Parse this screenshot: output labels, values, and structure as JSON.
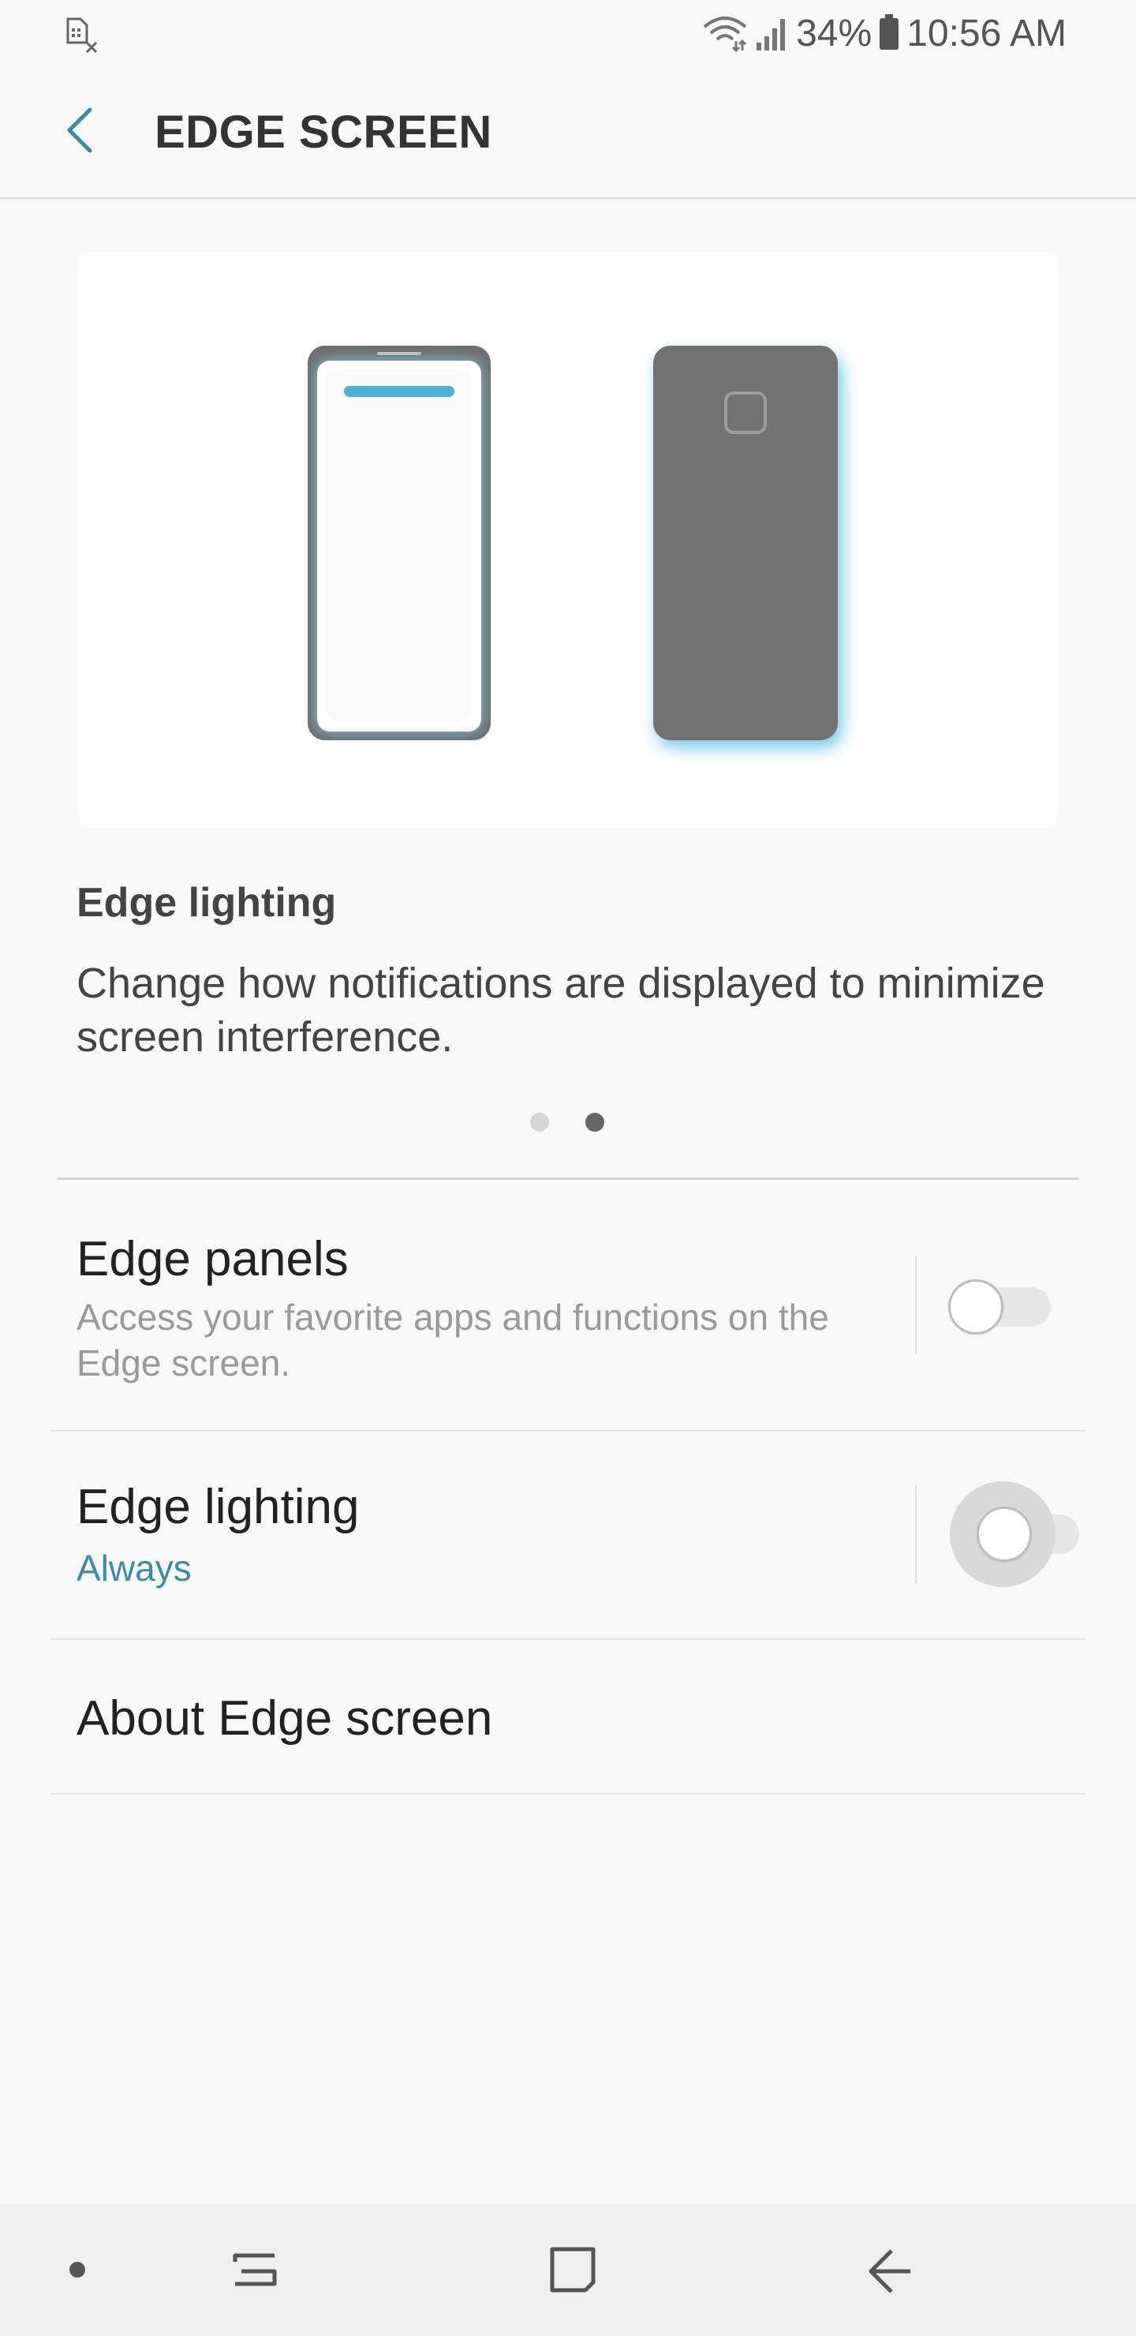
{
  "status_bar": {
    "battery_percent": "34%",
    "time": "10:56 AM",
    "icons": [
      "sim-card-off-icon",
      "wifi-icon",
      "signal-icon",
      "battery-icon"
    ]
  },
  "header": {
    "title": "EDGE SCREEN",
    "back_icon": "back-arrow-icon",
    "accent_color": "#3e8ba8"
  },
  "carousel": {
    "heading": "Edge lighting",
    "description": "Change how notifications are displayed to minimize screen interference.",
    "page_count": 2,
    "active_page": 2
  },
  "settings": [
    {
      "title": "Edge panels",
      "summary": "Access your favorite apps and functions on the Edge screen.",
      "switch_on": false
    },
    {
      "title": "Edge lighting",
      "summary": "Always",
      "switch_on": false
    },
    {
      "title": "About Edge screen"
    }
  ],
  "nav_bar": {
    "buttons": [
      "dot-icon",
      "recents-icon",
      "home-icon",
      "back-icon"
    ]
  }
}
